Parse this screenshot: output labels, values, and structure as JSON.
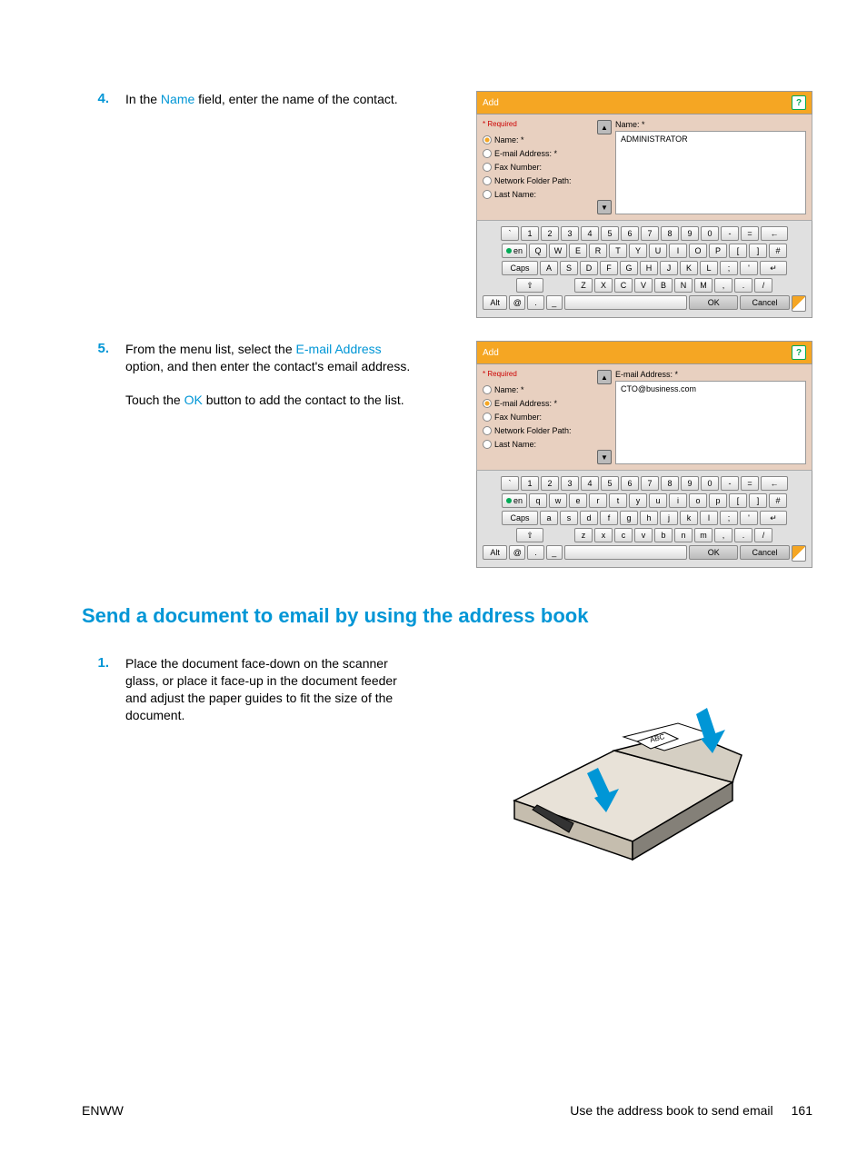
{
  "step4": {
    "num": "4.",
    "text_before": "In the ",
    "highlight": "Name",
    "text_after": " field, enter the name of the contact."
  },
  "step5": {
    "num": "5.",
    "p1_before": "From the menu list, select the ",
    "p1_highlight": "E-mail Address",
    "p1_after": " option, and then enter the contact's email address.",
    "p2_before": "Touch the ",
    "p2_highlight": "OK",
    "p2_after": " button to add the contact to the list."
  },
  "heading": "Send a document to email by using the address book",
  "step1": {
    "num": "1.",
    "text": "Place the document face-down on the scanner glass, or place it face-up in the document feeder and adjust the paper guides to fit the size of the document."
  },
  "screenshot1": {
    "title": "Add",
    "required": "* Required",
    "fields": {
      "name": "Name: *",
      "email": "E-mail Address: *",
      "fax": "Fax Number:",
      "folder": "Network Folder Path:",
      "lastname": "Last Name:"
    },
    "input_label": "Name: *",
    "input_value": "ADMINISTRATOR"
  },
  "screenshot2": {
    "title": "Add",
    "required": "* Required",
    "fields": {
      "name": "Name: *",
      "email": "E-mail Address: *",
      "fax": "Fax Number:",
      "folder": "Network Folder Path:",
      "lastname": "Last Name:"
    },
    "input_label": "E-mail Address: *",
    "input_value": "CTO@business.com"
  },
  "keyboard": {
    "row1": [
      "`",
      "1",
      "2",
      "3",
      "4",
      "5",
      "6",
      "7",
      "8",
      "9",
      "0",
      "-",
      "=",
      "←"
    ],
    "row2_upper": [
      "en",
      "Q",
      "W",
      "E",
      "R",
      "T",
      "Y",
      "U",
      "I",
      "O",
      "P",
      "[",
      "]",
      "#"
    ],
    "row2_lower": [
      "en",
      "q",
      "w",
      "e",
      "r",
      "t",
      "y",
      "u",
      "i",
      "o",
      "p",
      "[",
      "]",
      "#"
    ],
    "row3_upper": [
      "Caps",
      "A",
      "S",
      "D",
      "F",
      "G",
      "H",
      "J",
      "K",
      "L",
      ";",
      "'",
      "↵"
    ],
    "row3_lower": [
      "Caps",
      "a",
      "s",
      "d",
      "f",
      "g",
      "h",
      "j",
      "k",
      "l",
      ";",
      "'",
      "↵"
    ],
    "row4_upper": [
      "⇧",
      "Z",
      "X",
      "C",
      "V",
      "B",
      "N",
      "M",
      ",",
      ".",
      "/"
    ],
    "row4_lower": [
      "⇧",
      "z",
      "x",
      "c",
      "v",
      "b",
      "n",
      "m",
      ",",
      ".",
      "/"
    ],
    "row5": {
      "alt": "Alt",
      "at": "@",
      "ok": "OK",
      "cancel": "Cancel"
    }
  },
  "footer": {
    "left": "ENWW",
    "right": "Use the address book to send email",
    "page": "161"
  }
}
